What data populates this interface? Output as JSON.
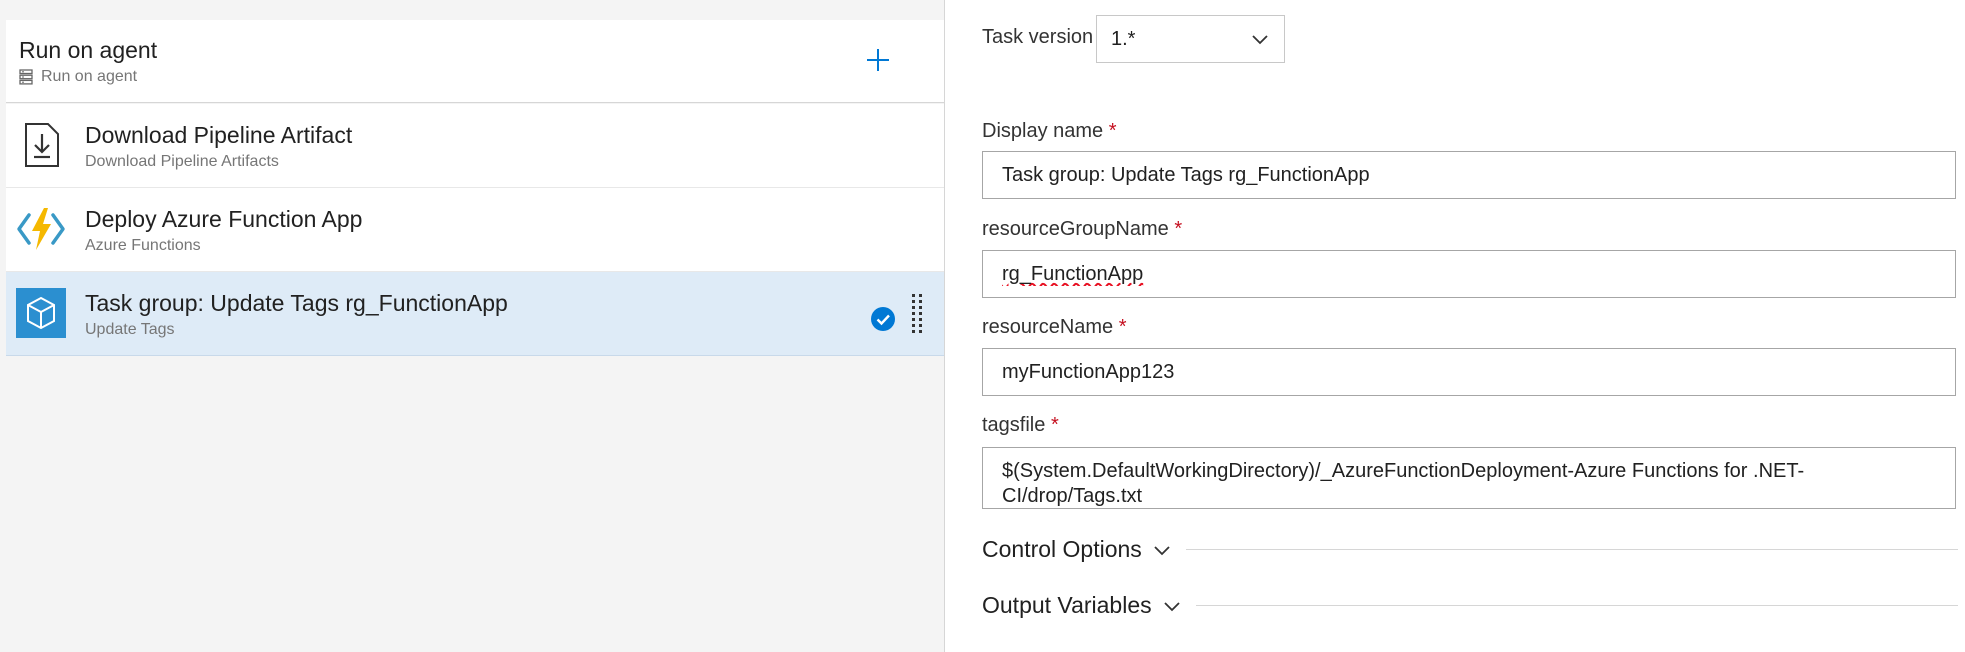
{
  "phase": {
    "title": "Run on agent",
    "subtitle": "Run on agent",
    "add_label": "+"
  },
  "tasks": [
    {
      "title": "Download Pipeline Artifact",
      "subtitle": "Download Pipeline Artifacts",
      "icon": "download-icon"
    },
    {
      "title": "Deploy Azure Function App",
      "subtitle": "Azure Functions",
      "icon": "azure-functions-icon"
    },
    {
      "title": "Task group: Update Tags rg_FunctionApp",
      "subtitle": "Update Tags",
      "icon": "task-group-icon",
      "selected": true
    }
  ],
  "details": {
    "task_version": {
      "label": "Task version",
      "value": "1.*"
    },
    "display_name": {
      "label": "Display name",
      "required": "*",
      "value": "Task group: Update Tags rg_FunctionApp"
    },
    "resource_group_name": {
      "label": "resourceGroupName",
      "required": "*",
      "value": "rg_FunctionApp"
    },
    "resource_name": {
      "label": "resourceName",
      "required": "*",
      "value": "myFunctionApp123"
    },
    "tagsfile": {
      "label": "tagsfile",
      "required": "*",
      "value": "$(System.DefaultWorkingDirectory)/_AzureFunctionDeployment-Azure Functions for .NET-CI/drop/Tags.txt"
    },
    "sections": [
      {
        "title": "Control Options"
      },
      {
        "title": "Output Variables"
      }
    ]
  },
  "colors": {
    "accent": "#0078d4",
    "selected_row": "#deebf7",
    "required": "#c50f1f",
    "functions_bolt": "#f5b800"
  }
}
